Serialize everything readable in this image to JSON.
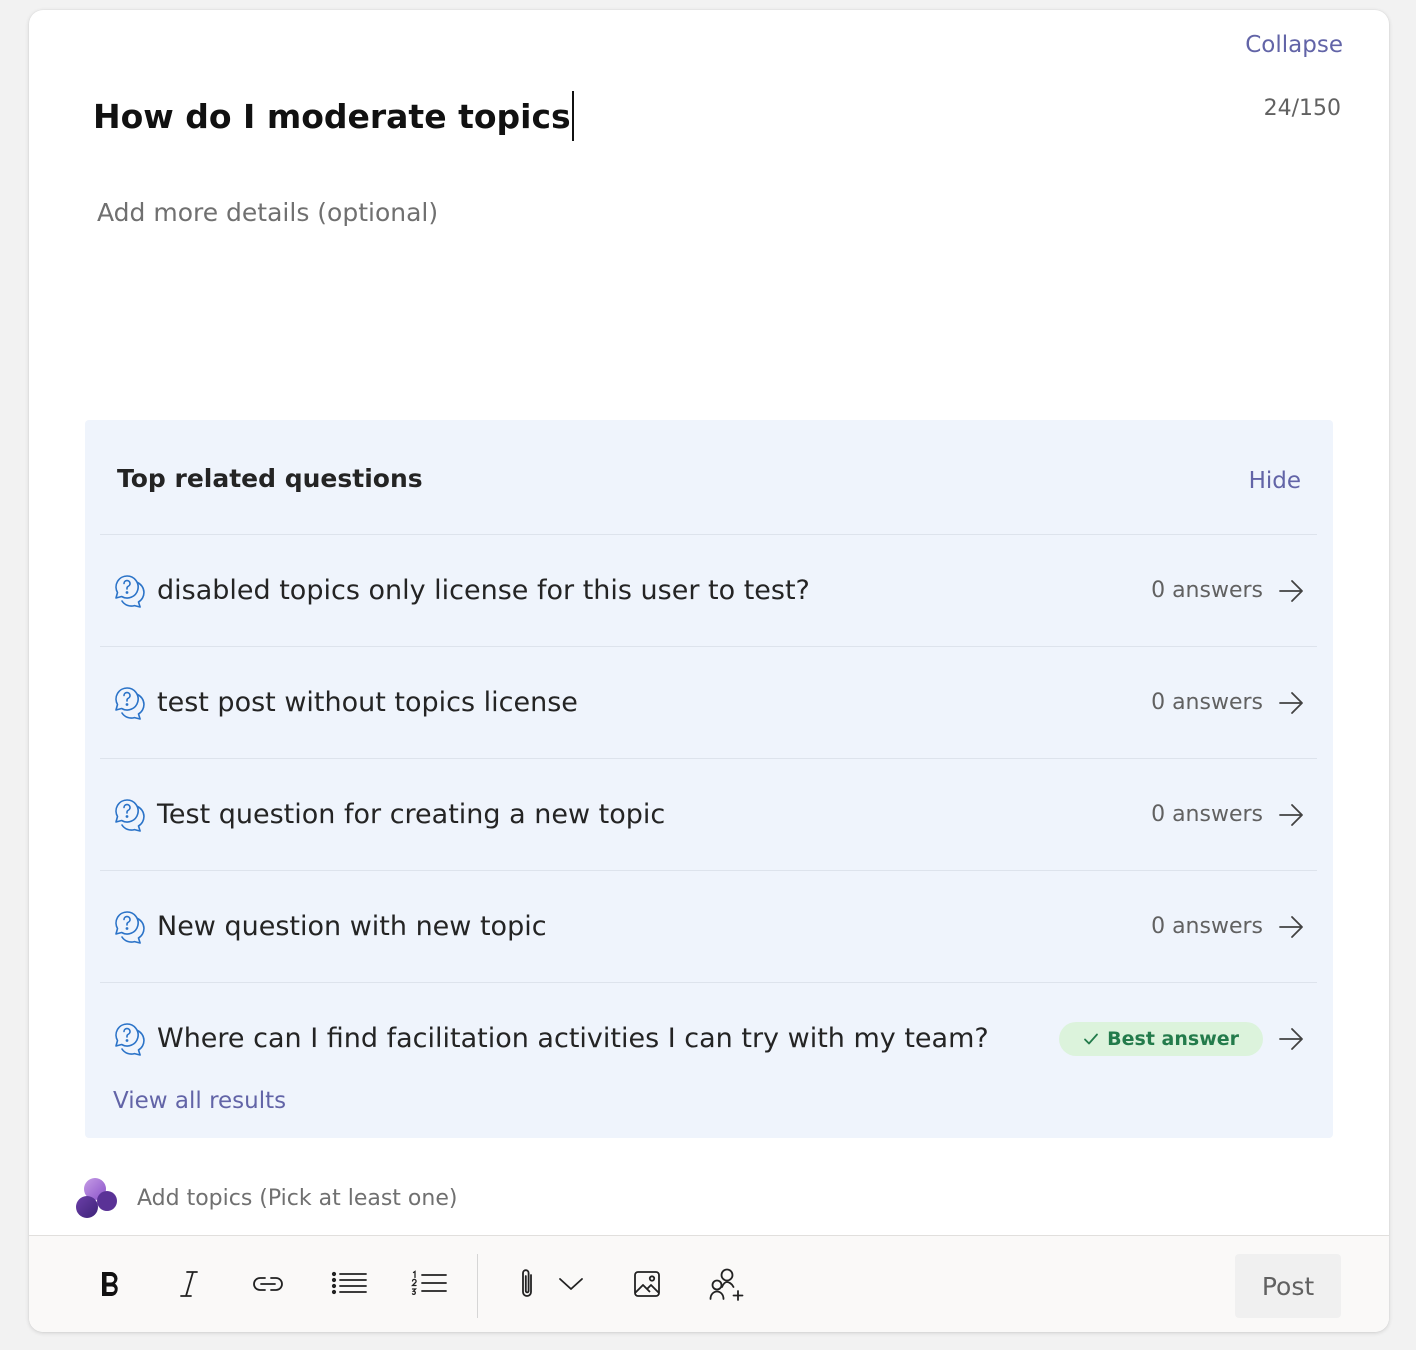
{
  "header": {
    "collapse_label": "Collapse",
    "title_value": "How do I moderate topics",
    "char_count": "24/150",
    "details_placeholder": "Add more details (optional)"
  },
  "related": {
    "title": "Top related questions",
    "hide_label": "Hide",
    "items": [
      {
        "text": "disabled topics only license for this user to test?",
        "meta": "0 answers"
      },
      {
        "text": "test post without topics license",
        "meta": "0 answers"
      },
      {
        "text": "Test question for creating a new topic",
        "meta": "0 answers"
      },
      {
        "text": "New question with new topic",
        "meta": "0 answers"
      },
      {
        "text": "Where can I find facilitation activities I can try with my team?",
        "badge": "Best answer"
      }
    ],
    "view_all_label": "View all results"
  },
  "topics": {
    "placeholder": "Add topics (Pick at least one)"
  },
  "toolbar": {
    "icons": [
      "bold-icon",
      "italic-icon",
      "link-icon",
      "bullet-list-icon",
      "numbered-list-icon",
      "attach-icon",
      "chevron-down-icon",
      "image-icon",
      "mention-icon"
    ],
    "post_label": "Post"
  },
  "colors": {
    "accent": "#6264a7",
    "panel_bg": "#eff4fc",
    "badge_bg": "#dcf3dc",
    "badge_text": "#237b4b",
    "question_icon": "#2b73c8"
  }
}
